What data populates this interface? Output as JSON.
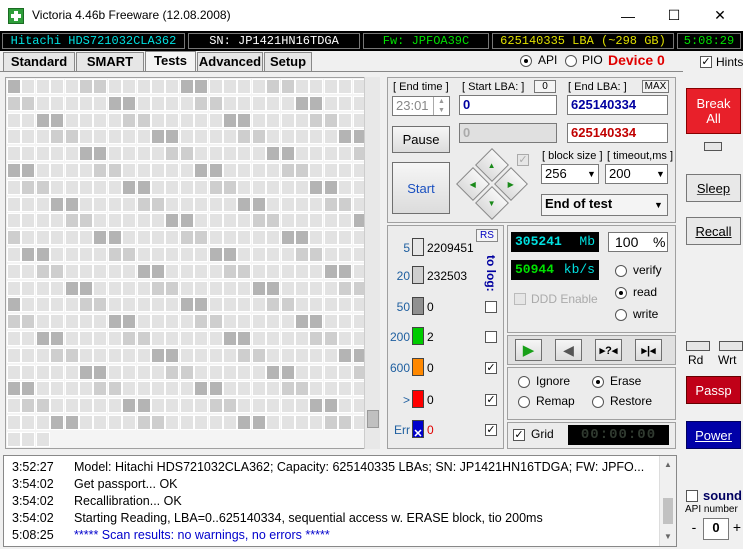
{
  "window": {
    "title": "Victoria 4.46b Freeware (12.08.2008)",
    "minimize": "—",
    "maximize": "☐",
    "close": "✕"
  },
  "infobar": {
    "model": "Hitachi HDS721032CLA362",
    "serial": "SN: JP1421HN16TDGA",
    "firmware": "Fw: JPFOA39C",
    "capacity": "625140335 LBA (~298 GB)",
    "clock": "5:08:29"
  },
  "mode": {
    "api": "API",
    "pio": "PIO",
    "device": "Device 0",
    "hints": "Hints"
  },
  "tabs": [
    "Standard",
    "SMART",
    "Tests",
    "Advanced",
    "Setup"
  ],
  "controls": {
    "end_time_label": "[ End time ]",
    "end_time_value": "23:01",
    "start_lba_label": "[ Start LBA: ]",
    "start_lba_zero": "0",
    "start_lba_value": "0",
    "start_lba_current": "0",
    "end_lba_label": "[ End LBA: ]",
    "end_lba_max": "MAX",
    "end_lba_value": "625140334",
    "end_lba_current": "625140334",
    "pause": "Pause",
    "start": "Start",
    "block_size_label": "[ block size ]",
    "block_size_value": "256",
    "timeout_label": "[ timeout,ms ]",
    "timeout_value": "200",
    "end_action": "End of test"
  },
  "stats": {
    "rs": "RS",
    "to_log": "to log:",
    "rows": [
      {
        "label": "5",
        "count": "2209451",
        "color": "#e6e6e6",
        "checked": false,
        "labelColor": "#2060a0"
      },
      {
        "label": "20",
        "count": "232503",
        "color": "#cfcfcf",
        "checked": false,
        "labelColor": "#2060a0"
      },
      {
        "label": "50",
        "count": "0",
        "color": "#909090",
        "checked": false,
        "labelColor": "#2060a0"
      },
      {
        "label": "200",
        "count": "2",
        "color": "#00cc00",
        "checked": false,
        "labelColor": "#2060a0"
      },
      {
        "label": "600",
        "count": "0",
        "color": "#ff8800",
        "checked": true,
        "labelColor": "#2060a0"
      },
      {
        "label": ">",
        "count": "0",
        "color": "#ff0000",
        "checked": true,
        "labelColor": "#2060a0"
      },
      {
        "label": "Err",
        "count": "0",
        "color": "#0000cc",
        "checked": true,
        "labelColor": "#2060a0"
      }
    ],
    "err_mark": "✕"
  },
  "readout": {
    "mb_value": "305241",
    "mb_unit": "Mb",
    "percent_value": "100",
    "percent_unit": "%",
    "speed_value": "50944",
    "speed_unit": "kb/s",
    "ddd_enable": "DDD Enable",
    "verify": "verify",
    "read": "read",
    "write": "write",
    "ignore": "Ignore",
    "erase": "Erase",
    "remap": "Remap",
    "restore": "Restore",
    "grid": "Grid",
    "timer": "00:00:00"
  },
  "right": {
    "break_all": "Break All",
    "sleep": "Sleep",
    "recall": "Recall",
    "rd": "Rd",
    "wrt": "Wrt",
    "passp": "Passp",
    "power": "Power",
    "sound": "sound",
    "api_number_label": "API number",
    "api_number_value": "0",
    "minus": "-",
    "plus": "+"
  },
  "log": [
    {
      "time": "3:52:27",
      "text": "Model: Hitachi HDS721032CLA362; Capacity: 625140335 LBAs; SN: JP1421HN16TDGA; FW: JPFO...",
      "color": "#000000"
    },
    {
      "time": "3:54:02",
      "text": "Get passport... OK",
      "color": "#000000"
    },
    {
      "time": "3:54:02",
      "text": "Recallibration... OK",
      "color": "#000000"
    },
    {
      "time": "3:54:02",
      "text": "Starting Reading, LBA=0..625140334, sequential access w. ERASE block, tio 200ms",
      "color": "#000000"
    },
    {
      "time": "5:08:25",
      "text": "***** Scan results: no warnings, no errors *****",
      "color": "#0000cc"
    }
  ],
  "colors": {
    "break_bg": "#e8202a",
    "passp_bg": "#c00018",
    "power_bg": "#0000a8",
    "lcd_green": "#00e000",
    "lcd_cyan": "#00e0e0",
    "info_cyan": "#00e0e0",
    "info_yellow": "#e0e000",
    "info_green": "#00e000"
  }
}
